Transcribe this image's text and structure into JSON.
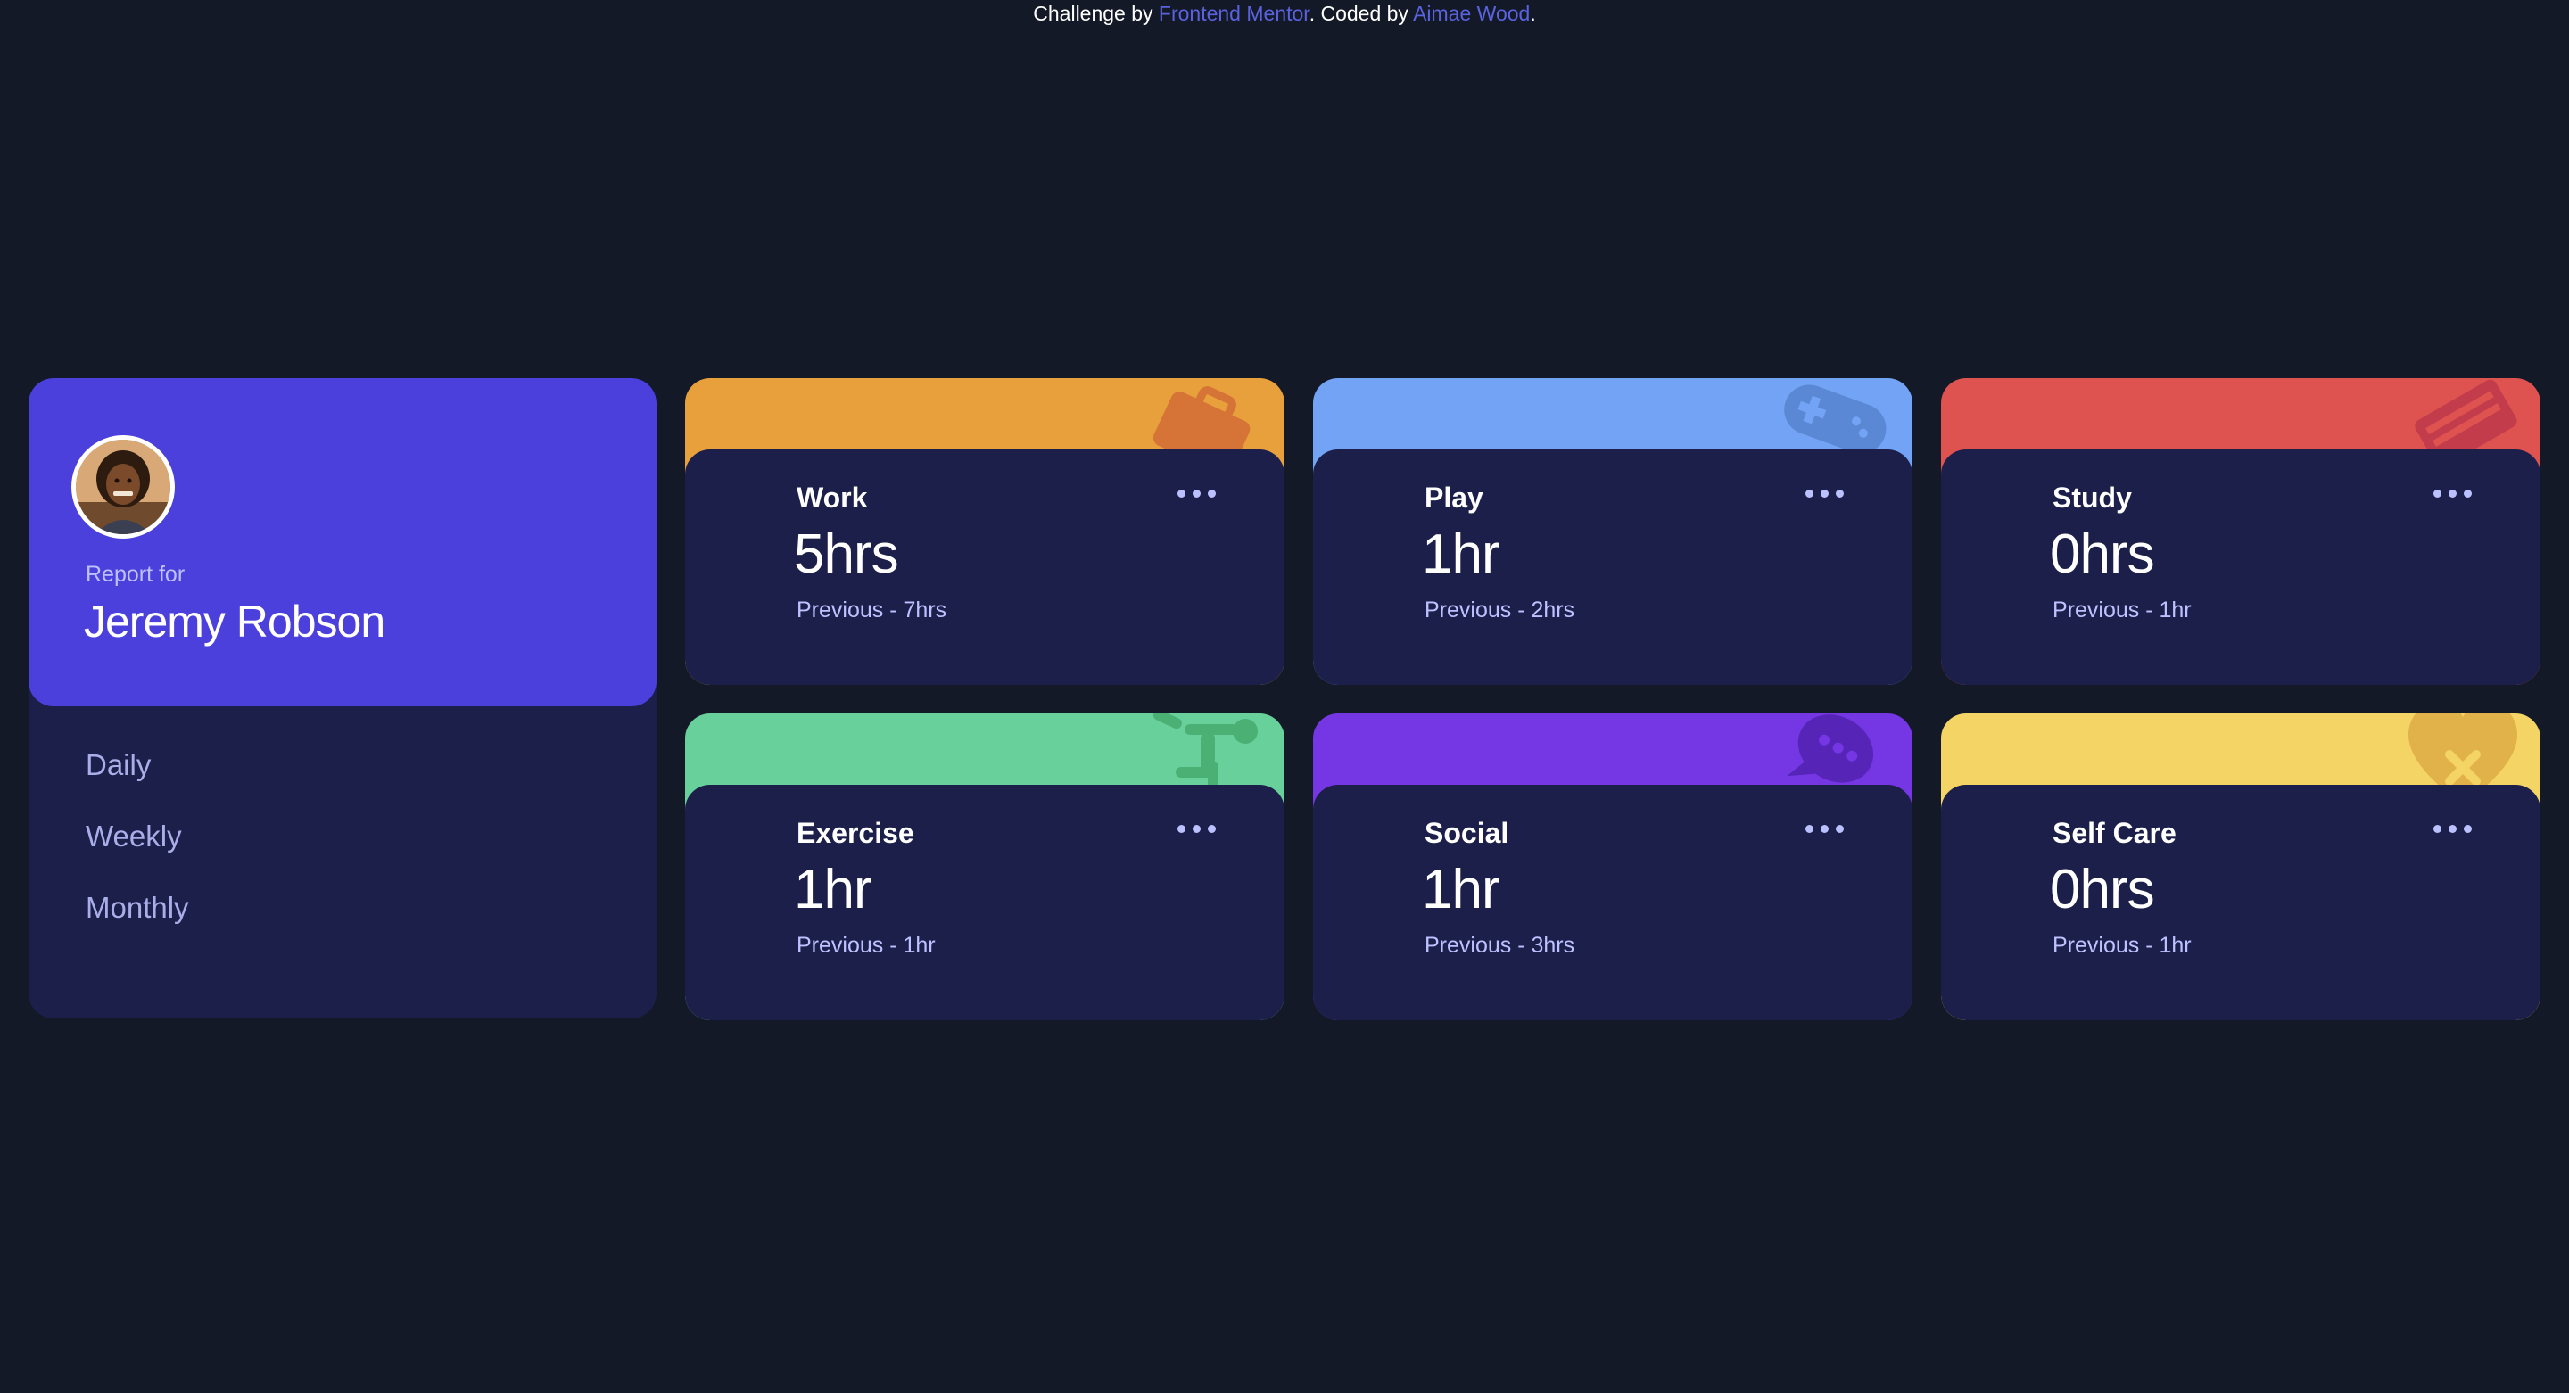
{
  "attribution": {
    "prefix": "Challenge by",
    "frontend_link": "Frontend Mentor",
    "middle": ". Coded by",
    "author_link": "Aimae Wood",
    "suffix": "."
  },
  "profile": {
    "report_label": "Report for",
    "name": "Jeremy Robson",
    "avatar_icon": "avatar-photo",
    "timeframes": [
      "Daily",
      "Weekly",
      "Monthly"
    ],
    "accent_color": "#4b40dc"
  },
  "activities": [
    {
      "title": "Work",
      "current": "5hrs",
      "previous": "Previous - 7hrs",
      "color": "#e8a03c",
      "icon": "briefcase-icon"
    },
    {
      "title": "Play",
      "current": "1hr",
      "previous": "Previous - 2hrs",
      "color": "#73a3f5",
      "icon": "game-controller-icon"
    },
    {
      "title": "Study",
      "current": "0hrs",
      "previous": "Previous - 1hr",
      "color": "#de5250",
      "icon": "book-icon"
    },
    {
      "title": "Exercise",
      "current": "1hr",
      "previous": "Previous - 1hr",
      "color": "#67d09b",
      "icon": "running-person-icon"
    },
    {
      "title": "Social",
      "current": "1hr",
      "previous": "Previous - 3hrs",
      "color": "#7536e4",
      "icon": "chat-bubble-icon"
    },
    {
      "title": "Self Care",
      "current": "0hrs",
      "previous": "Previous - 1hr",
      "color": "#f3d465",
      "icon": "heart-icon"
    }
  ],
  "colors": {
    "page_background": "#131927",
    "card_background": "#1c1f4a",
    "link": "#5a62e0"
  }
}
